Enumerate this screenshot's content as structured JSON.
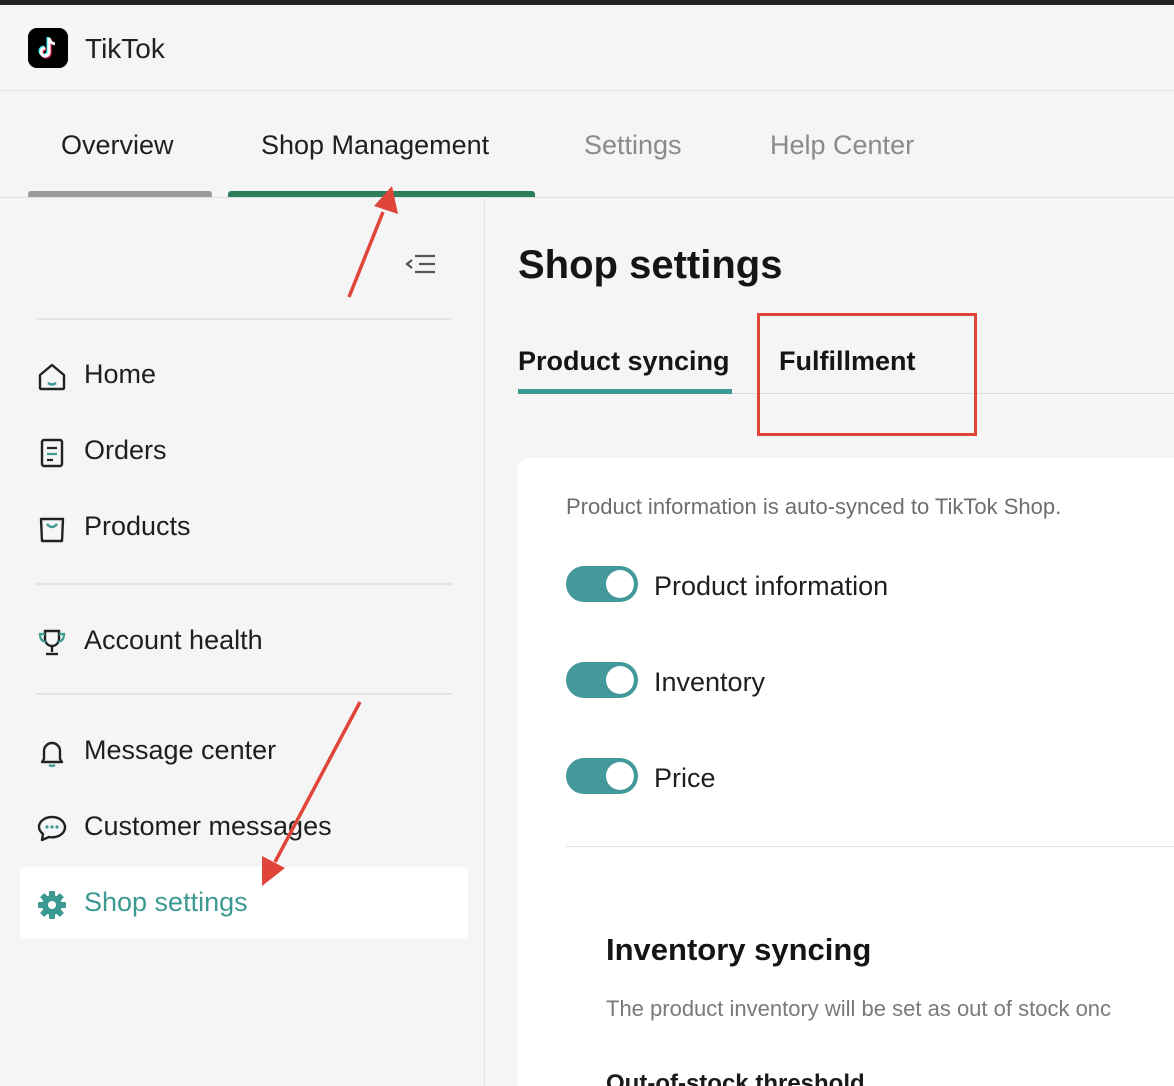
{
  "app": {
    "title": "TikTok",
    "logo_icon": "tiktok-logo-icon"
  },
  "nav": {
    "tabs": [
      {
        "label": "Overview",
        "state": "default"
      },
      {
        "label": "Shop Management",
        "state": "active"
      },
      {
        "label": "Settings",
        "state": "muted"
      },
      {
        "label": "Help Center",
        "state": "muted"
      }
    ],
    "active_color": "#2e7d5b",
    "inactive_underline_color": "#9a9a9a"
  },
  "sidebar": {
    "collapse_icon": "collapse-menu-icon",
    "items": [
      {
        "label": "Home",
        "icon": "home-icon"
      },
      {
        "label": "Orders",
        "icon": "orders-icon"
      },
      {
        "label": "Products",
        "icon": "shopping-bag-icon"
      },
      {
        "label": "Account health",
        "icon": "trophy-icon"
      },
      {
        "label": "Message center",
        "icon": "bell-icon"
      },
      {
        "label": "Customer messages",
        "icon": "chat-bubble-icon"
      },
      {
        "label": "Shop settings",
        "icon": "gear-icon",
        "active": true
      }
    ],
    "accent_color": "#3d9a92"
  },
  "main": {
    "title": "Shop settings",
    "tabs": [
      {
        "label": "Product syncing",
        "active": true
      },
      {
        "label": "Fulfillment",
        "active": false
      }
    ],
    "card": {
      "description": "Product information is auto-synced to TikTok Shop.",
      "toggles": [
        {
          "label": "Product information",
          "on": true
        },
        {
          "label": "Inventory",
          "on": true
        },
        {
          "label": "Price",
          "on": true
        }
      ],
      "toggle_color": "#44999a",
      "section_title": "Inventory syncing",
      "section_description": "The product inventory will be set as out of stock onc",
      "field_label": "Out-of-stock threshold"
    }
  },
  "annotation_color": "#e0453a"
}
